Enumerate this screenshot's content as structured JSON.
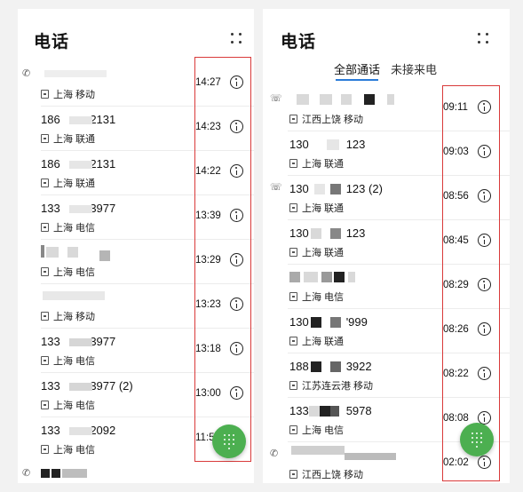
{
  "left_panel": {
    "title": "电话",
    "more_icon": "more-dots-icon",
    "calls": [
      {
        "name": "",
        "location": "上海 移动",
        "time": "14:27",
        "type_icon": "outgoing-call-icon"
      },
      {
        "name": "186 ",
        "name_suffix": "2131",
        "location": "上海 联通",
        "time": "14:23"
      },
      {
        "name": "186 ",
        "name_suffix": "2131",
        "location": "上海 联通",
        "time": "14:22"
      },
      {
        "name": "133 ",
        "name_suffix": "3977",
        "location": "上海 电信",
        "time": "13:39"
      },
      {
        "name": "",
        "location": "上海 电信",
        "time": "13:29"
      },
      {
        "name": "",
        "location": "上海 移动",
        "time": "13:23"
      },
      {
        "name": "133 ",
        "name_suffix": "3977",
        "location": "上海 电信",
        "time": "13:18"
      },
      {
        "name": "133 ",
        "name_suffix": "3977 (2)",
        "location": "上海 电信",
        "time": "13:00"
      },
      {
        "name": "133 ",
        "name_suffix": "2092",
        "location": "上海 电信",
        "time": "11:5"
      }
    ],
    "fab_icon": "dialpad-icon"
  },
  "right_panel": {
    "title": "电话",
    "more_icon": "more-dots-icon",
    "tabs": [
      {
        "label": "全部通话",
        "active": true
      },
      {
        "label": "未接来电",
        "active": false
      }
    ],
    "calls": [
      {
        "name": "",
        "location": "江西上饶 移动",
        "time": "09:11",
        "type_icon": "missed-call-icon"
      },
      {
        "name": "130",
        "name_suffix": "123",
        "location": "上海 联通",
        "time": "09:03"
      },
      {
        "name": "130",
        "name_suffix": "123 (2)",
        "location": "上海 联通",
        "time": "08:56",
        "type_icon": "missed-call-icon"
      },
      {
        "name": "130",
        "name_suffix": "123",
        "location": "上海 联通",
        "time": "08:45"
      },
      {
        "name": "",
        "location": "上海 电信",
        "time": "08:29"
      },
      {
        "name": "130",
        "name_suffix": "'999",
        "location": "上海 联通",
        "time": "08:26"
      },
      {
        "name": "188",
        "name_suffix": "3922",
        "location": "江苏连云港 移动",
        "time": "08:22"
      },
      {
        "name": "133",
        "name_suffix": "5978",
        "location": "上海 电信",
        "time": "08:08"
      },
      {
        "name": "",
        "location": "江西上饶 移动",
        "time": "02:02",
        "type_icon": "outgoing-call-icon"
      }
    ],
    "fab_icon": "dialpad-icon"
  },
  "highlight_color": "#d93a3a",
  "accent_color": "#2a7bd8",
  "fab_color": "#4caf50"
}
